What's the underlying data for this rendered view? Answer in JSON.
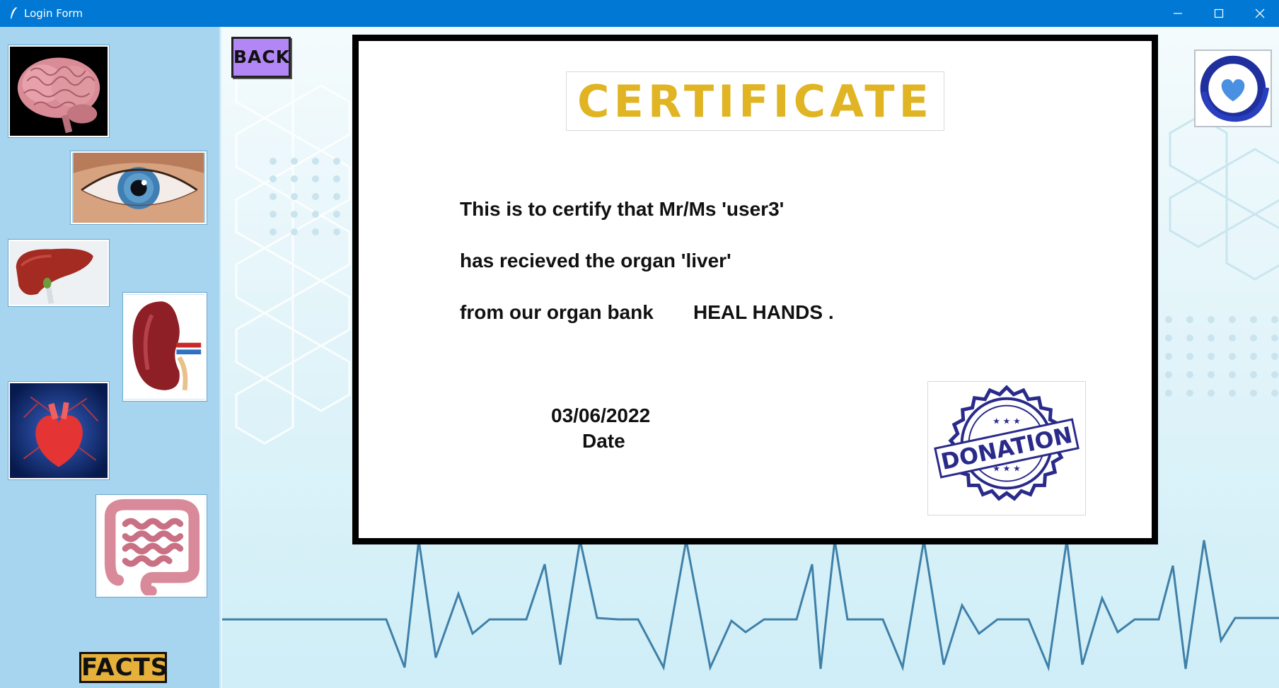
{
  "window": {
    "title": "Login Form"
  },
  "sidebar": {
    "organs": [
      "brain",
      "eye",
      "liver",
      "kidney",
      "heart",
      "intestine"
    ],
    "facts_label": "FACTS"
  },
  "toolbar": {
    "back_label": "BACK"
  },
  "certificate": {
    "title": "CERTIFICATE",
    "line1": "This is to certify that Mr/Ms 'user3'",
    "line2": "has recieved the organ 'liver'",
    "line3_prefix": "from our organ bank",
    "bank_name": "HEAL HANDS .",
    "date_value": "03/06/2022",
    "date_label": "Date",
    "stamp_text": "DONATION"
  },
  "colors": {
    "titlebar": "#0078d4",
    "sidebar": "#a7d4ee",
    "back_button": "#b287f5",
    "facts_button": "#e6b13a",
    "certificate_title": "#e0b422",
    "stamp": "#2a2a8a"
  }
}
